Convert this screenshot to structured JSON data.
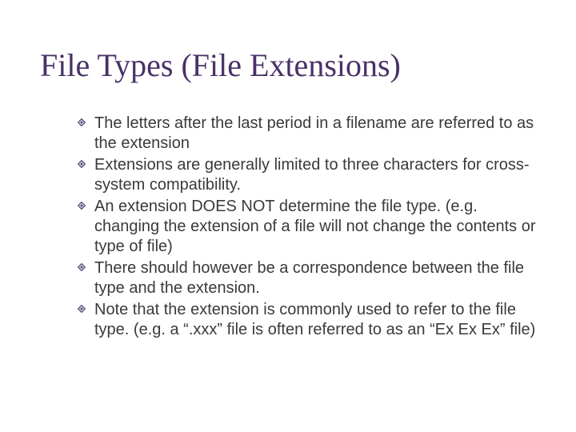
{
  "title": "File Types (File Extensions)",
  "bullets": [
    "The letters after the last period in a filename are referred to as the extension",
    "Extensions are generally limited to three characters for cross-system compatibility.",
    "An extension DOES NOT determine the file type.  (e.g. changing the extension of a file will not change the contents or type of file)",
    "There should however be a correspondence between the file type and the extension.",
    "Note that the extension is commonly used to refer to the file type.  (e.g. a “.xxx” file is often referred to as an “Ex Ex Ex” file)"
  ]
}
